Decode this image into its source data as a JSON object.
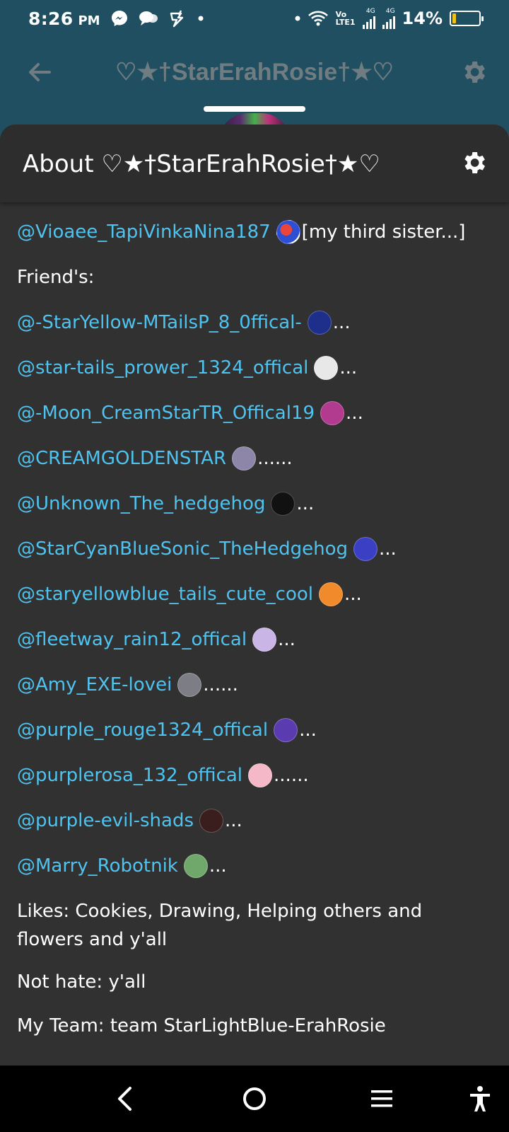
{
  "status_bar": {
    "time": "8:26",
    "ampm": "PM",
    "network_top": "Vo",
    "network_bottom": "LTE1",
    "signal_label_1": "4G",
    "signal_label_2": "4G",
    "battery_percent": "14%",
    "battery_level": 0.14,
    "battery_color": "#f2c21b"
  },
  "header": {
    "title": "♡★†StarErahRosie†★♡",
    "back_icon": "arrow-left-icon",
    "settings_icon": "gear-icon"
  },
  "sheet": {
    "title": "About ♡★†StarErahRosie†★♡",
    "settings_icon": "gear-icon",
    "sister_row": {
      "mention": "@Vioaee_TapiVinkaNina187",
      "after": "[my third sister...]"
    },
    "friends_label": "Friend's:",
    "friends": [
      {
        "mention": "@-StarYellow-MTailsP_8_0ffical-",
        "after": "...",
        "avatar_color": "#1d2f8a"
      },
      {
        "mention": "@star-tails_prower_1324_offical",
        "after": "...",
        "avatar_color": "#e8e8e8"
      },
      {
        "mention": "@-Moon_CreamStarTR_Offical19",
        "after": "...",
        "avatar_color": "#b23a8f"
      },
      {
        "mention": "@CREAMGOLDENSTAR",
        "after": "......",
        "avatar_color": "#8d86a8"
      },
      {
        "mention": "@Unknown_The_hedgehog",
        "after": "...",
        "avatar_color": "#111111"
      },
      {
        "mention": "@StarCyanBlueSonic_TheHedgehog",
        "after": "...",
        "avatar_color": "#3b3fc4"
      },
      {
        "mention": "@staryellowblue_tails_cute_cool",
        "after": "...",
        "avatar_color": "#f08a2a"
      },
      {
        "mention": "@fleetway_rain12_offical",
        "after": "...",
        "avatar_color": "#c9b6e6"
      },
      {
        "mention": "@Amy_EXE-lovei",
        "after": "......",
        "avatar_color": "#7d7d86"
      },
      {
        "mention": "@purple_rouge1324_offical",
        "after": "...",
        "avatar_color": "#5b3bb0"
      },
      {
        "mention": "@purplerosa_132_offical",
        "after": "......",
        "avatar_color": "#f4b8c8"
      },
      {
        "mention": "@purple-evil-shads",
        "after": "...",
        "avatar_color": "#3a1d1d"
      },
      {
        "mention": "@Marry_Robotnik",
        "after": "...",
        "avatar_color": "#6fa86a"
      }
    ],
    "likes": "Likes: Cookies, Drawing, Helping others and flowers and y'all",
    "not_hate": "Not hate: y'all",
    "team": "My Team: team StarLightBlue-ErahRosie"
  },
  "nav_bar": {
    "back_icon": "chevron-left-icon",
    "home_icon": "circle-home-icon",
    "recents_icon": "menu-lines-icon",
    "accessibility_icon": "accessibility-icon"
  },
  "colors": {
    "header_bg": "#1f4f60",
    "sheet_bg": "#323131",
    "mention": "#4fc3f0"
  }
}
